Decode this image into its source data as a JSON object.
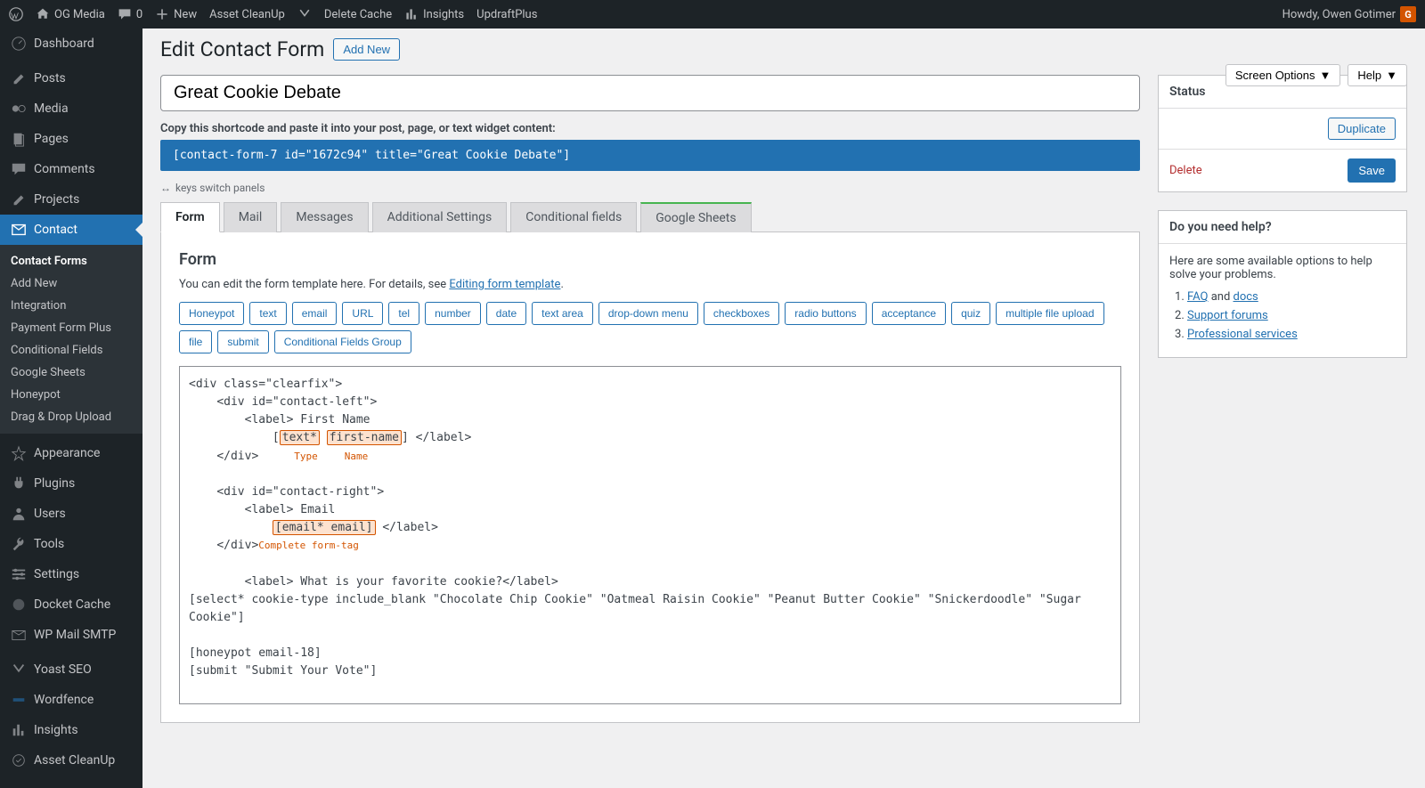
{
  "topbar": {
    "site": "OG Media",
    "comments": "0",
    "new": "New",
    "items": [
      "Asset CleanUp",
      "Delete Cache",
      "Insights",
      "UpdraftPlus"
    ],
    "howdy": "Howdy, Owen Gotimer",
    "avatar_initial": "G"
  },
  "top_actions": {
    "screen_options": "Screen Options",
    "help": "Help"
  },
  "sidebar": {
    "items": [
      {
        "label": "Dashboard"
      },
      {
        "label": "Posts"
      },
      {
        "label": "Media"
      },
      {
        "label": "Pages"
      },
      {
        "label": "Comments"
      },
      {
        "label": "Projects"
      },
      {
        "label": "Contact"
      }
    ],
    "submenu": [
      "Contact Forms",
      "Add New",
      "Integration",
      "Payment Form Plus",
      "Conditional Fields",
      "Google Sheets",
      "Honeypot",
      "Drag & Drop Upload"
    ],
    "items2": [
      {
        "label": "Appearance"
      },
      {
        "label": "Plugins"
      },
      {
        "label": "Users"
      },
      {
        "label": "Tools"
      },
      {
        "label": "Settings"
      },
      {
        "label": "Docket Cache"
      },
      {
        "label": "WP Mail SMTP"
      }
    ],
    "items3": [
      {
        "label": "Yoast SEO"
      },
      {
        "label": "Wordfence"
      },
      {
        "label": "Insights"
      },
      {
        "label": "Asset CleanUp"
      }
    ]
  },
  "page": {
    "title": "Edit Contact Form",
    "add_new": "Add New",
    "form_title": "Great Cookie Debate",
    "shortcode_hint": "Copy this shortcode and paste it into your post, page, or text widget content:",
    "shortcode": "[contact-form-7 id=\"1672c94\" title=\"Great Cookie Debate\"]",
    "keys_hint": "keys switch panels"
  },
  "tabs": [
    "Form",
    "Mail",
    "Messages",
    "Additional Settings",
    "Conditional fields",
    "Google Sheets"
  ],
  "form_panel": {
    "heading": "Form",
    "desc_pre": "You can edit the form template here. For details, see ",
    "desc_link": "Editing form template",
    "tags": [
      "Honeypot",
      "text",
      "email",
      "URL",
      "tel",
      "number",
      "date",
      "text area",
      "drop-down menu",
      "checkboxes",
      "radio buttons",
      "acceptance",
      "quiz",
      "multiple file upload",
      "file",
      "submit",
      "Conditional Fields Group"
    ]
  },
  "code": {
    "l1": "<div class=\"clearfix\">",
    "l2": "    <div id=\"contact-left\">",
    "l3": "        <label> First Name",
    "l4a": "            [",
    "l4b": "text*",
    "l4c": " ",
    "l4d": "first-name",
    "l4e": "] </label>",
    "l5": "    </div>",
    "ann_type": "Type",
    "ann_name": "Name",
    "l7": "    <div id=\"contact-right\">",
    "l8": "        <label> Email",
    "l9a": "            ",
    "l9b": "[email* email]",
    "l9c": " </label>",
    "l10": "    </div>",
    "ann_complete": "Complete form-tag",
    "l12": "        <label> What is your favorite cookie?</label>",
    "l13": "[select* cookie-type include_blank \"Chocolate Chip Cookie\" \"Oatmeal Raisin Cookie\" \"Peanut Butter Cookie\" \"Snickerdoodle\" \"Sugar Cookie\"]",
    "l15": "[honeypot email-18]",
    "l16": "[submit \"Submit Your Vote\"]"
  },
  "status": {
    "title": "Status",
    "duplicate": "Duplicate",
    "delete": "Delete",
    "save": "Save"
  },
  "help": {
    "title": "Do you need help?",
    "intro": "Here are some available options to help solve your problems.",
    "faq": "FAQ",
    "and": " and ",
    "docs": "docs",
    "support": "Support forums",
    "pro": "Professional services"
  }
}
